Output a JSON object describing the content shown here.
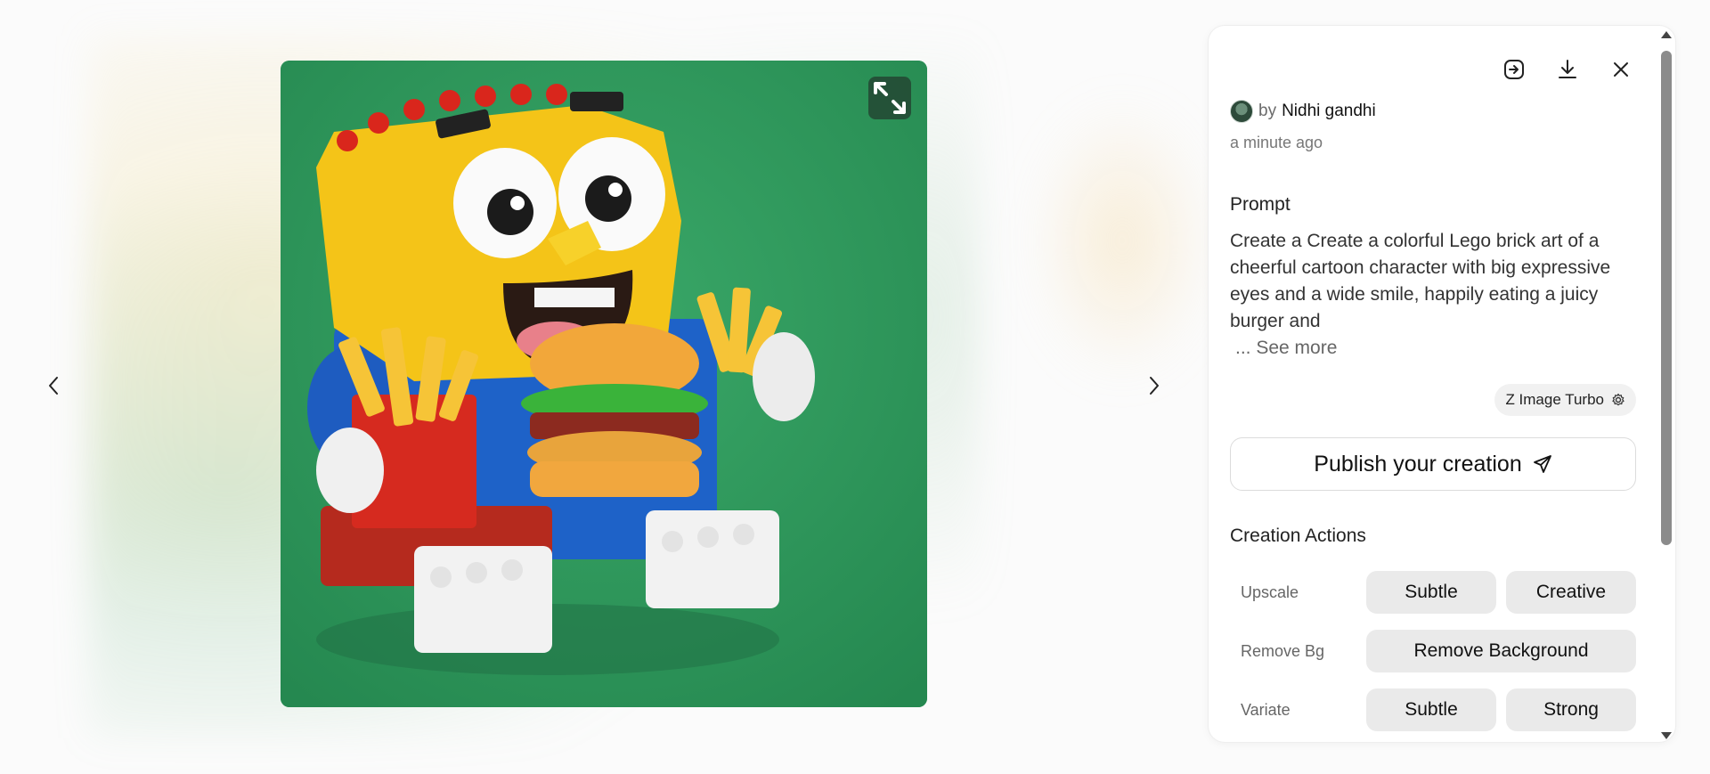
{
  "author": {
    "by": "by",
    "name": "Nidhi gandhi",
    "time": "a minute ago"
  },
  "prompt": {
    "heading": "Prompt",
    "text": "Create a Create a colorful Lego brick art of a cheerful cartoon character with big expressive eyes and a wide smile, happily eating a juicy burger and",
    "see_more": "... See more"
  },
  "model": {
    "label": "Z Image Turbo"
  },
  "publish": {
    "label": "Publish your creation"
  },
  "actions": {
    "heading": "Creation Actions",
    "rows": [
      {
        "label": "Upscale",
        "buttons": [
          "Subtle",
          "Creative"
        ]
      },
      {
        "label": "Remove Bg",
        "buttons": [
          "Remove Background"
        ]
      },
      {
        "label": "Variate",
        "buttons": [
          "Subtle",
          "Strong"
        ]
      }
    ]
  },
  "icons": {
    "toolbar": [
      "share-icon",
      "download-icon",
      "close-icon"
    ],
    "expand": "expand-icon",
    "prev": "chevron-left-icon",
    "next": "chevron-right-icon",
    "model_settings": "settings-icon",
    "publish": "send-icon"
  },
  "colors": {
    "image_background": "#2f9a5d",
    "pill": "#eaeaea"
  }
}
